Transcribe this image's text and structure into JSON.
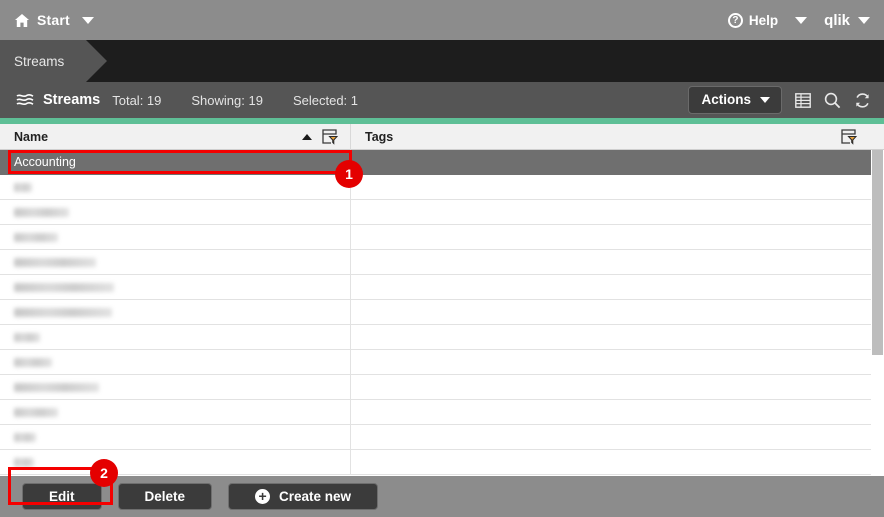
{
  "topbar": {
    "start_label": "Start",
    "home_icon": "home-icon",
    "start_caret_icon": "chevron-down-icon",
    "help_label": "Help",
    "help_icon": "help-circle-icon",
    "help_caret_icon": "chevron-down-icon",
    "account_label": "qlik",
    "account_caret_icon": "chevron-down-icon"
  },
  "breadcrumb": {
    "items": [
      {
        "label": "Streams"
      }
    ]
  },
  "toolbar": {
    "icon": "streams-icon",
    "title": "Streams",
    "total": "Total: 19",
    "showing": "Showing: 19",
    "selected": "Selected: 1",
    "actions_label": "Actions",
    "actions_caret_icon": "chevron-down-icon",
    "grid_icon": "table-columns-icon",
    "search_icon": "search-icon",
    "refresh_icon": "refresh-icon",
    "accent_color": "#5ebf96"
  },
  "table": {
    "columns": [
      {
        "label": "Name",
        "sort": "asc",
        "sort_icon": "sort-ascending-icon",
        "filter_icon": "filter-icon"
      },
      {
        "label": "Tags",
        "sort": "none",
        "filter_icon": "filter-icon"
      }
    ],
    "rows": [
      {
        "name": "Accounting",
        "tags": "",
        "selected": true,
        "redacted": false,
        "redact_width": 0
      },
      {
        "name": "",
        "tags": "",
        "selected": false,
        "redacted": true,
        "redact_width": 18
      },
      {
        "name": "",
        "tags": "",
        "selected": false,
        "redacted": true,
        "redact_width": 55
      },
      {
        "name": "",
        "tags": "",
        "selected": false,
        "redacted": true,
        "redact_width": 44
      },
      {
        "name": "",
        "tags": "",
        "selected": false,
        "redacted": true,
        "redact_width": 82
      },
      {
        "name": "",
        "tags": "",
        "selected": false,
        "redacted": true,
        "redact_width": 100
      },
      {
        "name": "",
        "tags": "",
        "selected": false,
        "redacted": true,
        "redact_width": 98
      },
      {
        "name": "",
        "tags": "",
        "selected": false,
        "redacted": true,
        "redact_width": 26
      },
      {
        "name": "",
        "tags": "",
        "selected": false,
        "redacted": true,
        "redact_width": 38
      },
      {
        "name": "",
        "tags": "",
        "selected": false,
        "redacted": true,
        "redact_width": 85
      },
      {
        "name": "",
        "tags": "",
        "selected": false,
        "redacted": true,
        "redact_width": 44
      },
      {
        "name": "",
        "tags": "",
        "selected": false,
        "redacted": true,
        "redact_width": 22
      },
      {
        "name": "",
        "tags": "",
        "selected": false,
        "redacted": true,
        "redact_width": 20
      }
    ],
    "scrollbar": {
      "name": "vertical-scrollbar"
    }
  },
  "bottombar": {
    "edit_label": "Edit",
    "delete_label": "Delete",
    "create_label": "Create new",
    "create_icon": "plus-circle-icon"
  },
  "annotations": {
    "marker_color": "#e40000",
    "items": [
      {
        "number": "1",
        "target": "selected-row-accounting"
      },
      {
        "number": "2",
        "target": "edit-button"
      }
    ]
  }
}
